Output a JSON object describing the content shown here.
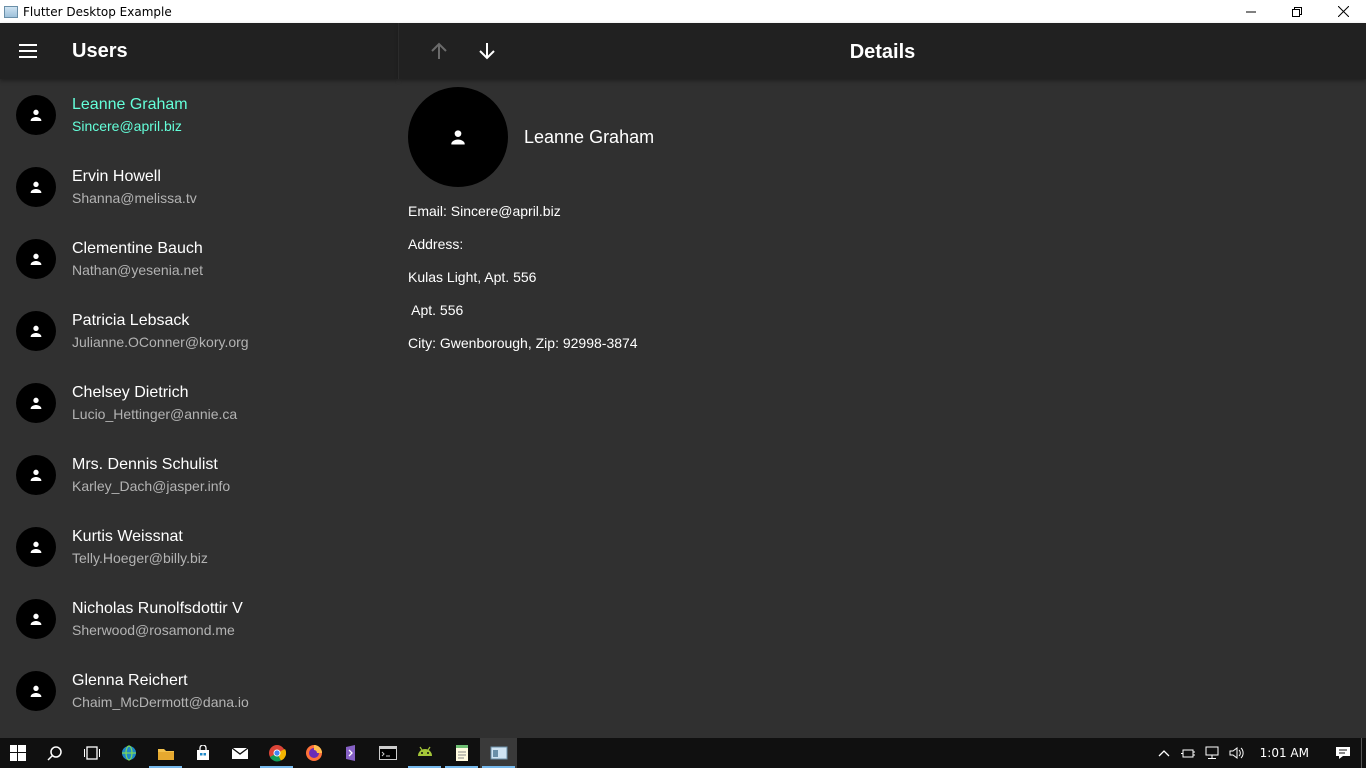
{
  "window": {
    "title": "Flutter Desktop Example"
  },
  "list_panel": {
    "title": "Users"
  },
  "details_panel": {
    "title": "Details"
  },
  "users": [
    {
      "name": "Leanne Graham",
      "email": "Sincere@april.biz",
      "selected": true
    },
    {
      "name": "Ervin Howell",
      "email": "Shanna@melissa.tv"
    },
    {
      "name": "Clementine Bauch",
      "email": "Nathan@yesenia.net"
    },
    {
      "name": "Patricia Lebsack",
      "email": "Julianne.OConner@kory.org"
    },
    {
      "name": "Chelsey Dietrich",
      "email": "Lucio_Hettinger@annie.ca"
    },
    {
      "name": "Mrs. Dennis Schulist",
      "email": "Karley_Dach@jasper.info"
    },
    {
      "name": "Kurtis Weissnat",
      "email": "Telly.Hoeger@billy.biz"
    },
    {
      "name": "Nicholas Runolfsdottir V",
      "email": "Sherwood@rosamond.me"
    },
    {
      "name": "Glenna Reichert",
      "email": "Chaim_McDermott@dana.io"
    }
  ],
  "details": {
    "name": "Leanne Graham",
    "email_line": "Email: Sincere@april.biz",
    "address_label": "Address:",
    "street_line": "Kulas Light, Apt. 556",
    "suite_line": " Apt. 556",
    "city_line": "City: Gwenborough, Zip: 92998-3874"
  },
  "taskbar": {
    "clock": "1:01 AM"
  },
  "colors": {
    "accent": "#64ffda",
    "appbar": "#212121",
    "background": "#303030"
  }
}
